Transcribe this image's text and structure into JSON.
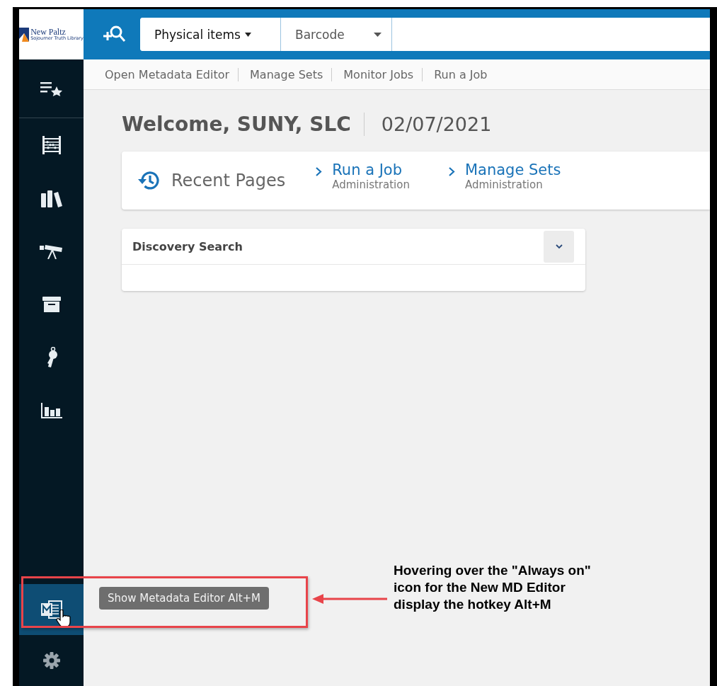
{
  "logo": {
    "name": "New Paltz",
    "subtitle": "Sojourner Truth Library"
  },
  "search_bar": {
    "scope": "Physical items",
    "field": "Barcode"
  },
  "quick_links": [
    "Open Metadata Editor",
    "Manage Sets",
    "Monitor Jobs",
    "Run a Job"
  ],
  "sidebar": {
    "items": [
      {
        "kind": "favorites",
        "hovered": false
      },
      {
        "kind": "abacus",
        "hovered": false
      },
      {
        "kind": "books",
        "hovered": false
      },
      {
        "kind": "telescope",
        "hovered": false
      },
      {
        "kind": "archive",
        "hovered": false
      },
      {
        "kind": "key",
        "hovered": false
      },
      {
        "kind": "chart",
        "hovered": false
      }
    ],
    "bottom_items": [
      {
        "kind": "metadata-editor",
        "hovered": true
      },
      {
        "kind": "settings",
        "hovered": false
      }
    ]
  },
  "welcome": {
    "greeting": "Welcome, SUNY, SLC",
    "date": "02/07/2021"
  },
  "recent_pages": {
    "title": "Recent Pages",
    "items": [
      {
        "label": "Run a Job",
        "category": "Administration"
      },
      {
        "label": "Manage Sets",
        "category": "Administration"
      }
    ]
  },
  "widget": {
    "title": "Discovery Search",
    "expanded": false
  },
  "tooltip": "Show Metadata Editor Alt+M",
  "annotation": "Hovering over the \"Always on\" icon for the New MD Editor display the hotkey Alt+M"
}
